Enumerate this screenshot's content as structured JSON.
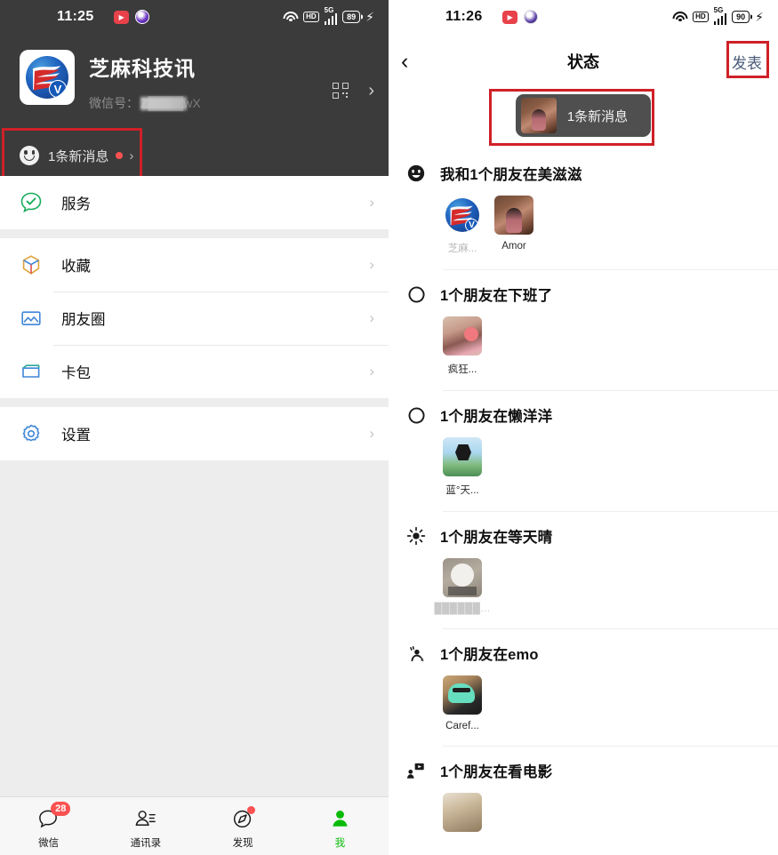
{
  "left_panel": {
    "statusbar": {
      "time": "11:25",
      "battery": "89",
      "network": "5G",
      "hd_label": "HD",
      "icons": [
        "screen-record-icon",
        "camera-lens-icon",
        "wifi-icon",
        "hd-icon",
        "signal-bars-icon",
        "battery-icon",
        "charging-bolt-icon"
      ]
    },
    "profile": {
      "name": "芝麻科技讯",
      "id_label": "微信号：",
      "id_value": "Z████wX",
      "qr_icon": "qr-code-icon",
      "chevron": "›"
    },
    "status_entry": {
      "label": "1条新消息",
      "icon": "smiley-face-icon",
      "has_unread_dot": true,
      "chevron": "›"
    },
    "menu": [
      {
        "label": "服务",
        "icon": "services-check-icon",
        "chevron": "›"
      },
      {
        "label": "收藏",
        "icon": "favorites-box-icon",
        "chevron": "›"
      },
      {
        "label": "朋友圈",
        "icon": "moments-photo-icon",
        "chevron": "›"
      },
      {
        "label": "卡包",
        "icon": "cards-wallet-icon",
        "chevron": "›"
      },
      {
        "label": "设置",
        "icon": "settings-gear-icon",
        "chevron": "›"
      }
    ],
    "tabbar": [
      {
        "label": "微信",
        "icon": "chat-bubble-icon",
        "badge": "28",
        "active": false
      },
      {
        "label": "通讯录",
        "icon": "contacts-icon",
        "badge": "",
        "active": false
      },
      {
        "label": "发现",
        "icon": "discover-compass-icon",
        "badge": "",
        "active": false
      },
      {
        "label": "我",
        "icon": "me-person-icon",
        "badge": "",
        "active": true
      }
    ]
  },
  "right_panel": {
    "statusbar": {
      "time": "11:26",
      "battery": "90",
      "network": "5G",
      "hd_label": "HD"
    },
    "navbar": {
      "back_icon": "back-chevron-icon",
      "title": "状态",
      "action_label": "发表"
    },
    "banner": {
      "text": "1条新消息",
      "thumb": "amor-avatar-thumb"
    },
    "groups": [
      {
        "icon": "smiley-face-icon",
        "title": "我和1个朋友在美滋滋",
        "friends": [
          {
            "name": "芝麻...",
            "thumb": "zhima-logo-thumb",
            "muted": true
          },
          {
            "name": "Amor",
            "thumb": "amor-avatar-thumb",
            "muted": false
          }
        ]
      },
      {
        "icon": "circle-outline-icon",
        "title": "1个朋友在下班了",
        "friends": [
          {
            "name": "疯狂...",
            "thumb": "crazy-avatar-thumb",
            "muted": false
          }
        ]
      },
      {
        "icon": "circle-outline-icon",
        "title": "1个朋友在懒洋洋",
        "friends": [
          {
            "name": "蓝°天...",
            "thumb": "bluesky-avatar-thumb",
            "muted": false
          }
        ]
      },
      {
        "icon": "sun-rays-icon",
        "title": "1个朋友在等天晴",
        "friends": [
          {
            "name": "██████...",
            "thumb": "dog-avatar-thumb",
            "muted": false,
            "blurred": true
          }
        ]
      },
      {
        "icon": "person-crying-emo-icon",
        "title": "1个朋友在emo",
        "friends": [
          {
            "name": "Caref...",
            "thumb": "dino-avatar-thumb",
            "muted": false
          }
        ]
      },
      {
        "icon": "movie-screen-icon",
        "title": "1个朋友在看电影",
        "friends": [
          {
            "name": "",
            "thumb": "movie-avatar-thumb",
            "muted": false
          }
        ]
      }
    ]
  },
  "annotations": {
    "highlight_color": "#cf2027",
    "boxes": [
      "status-entry-highlight",
      "publish-button-highlight",
      "new-message-banner-highlight"
    ]
  }
}
